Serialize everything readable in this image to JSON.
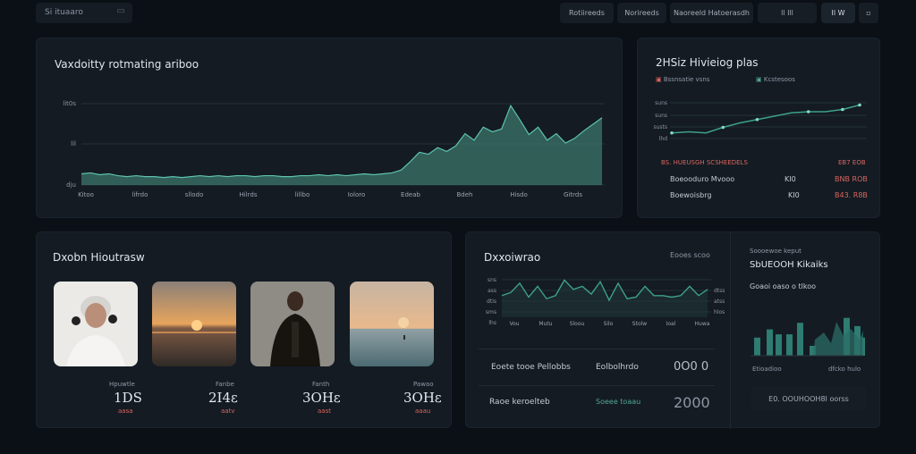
{
  "header": {
    "search": "Si ituaaro",
    "buttons": [
      "Rotiireeds",
      "Norireeds",
      "Naoreeld Hatoerasdh"
    ],
    "icon_buttons": [
      "ll Ill",
      "Il W"
    ]
  },
  "volatility": {
    "title": "Vaxdoitty rotmating ariboo",
    "y_ticks": [
      "lit0s",
      "lil",
      "dju"
    ],
    "x_ticks": [
      "Kitoo",
      "lifrdo",
      "sllodo",
      "Hilrds",
      "lillbo",
      "Ioloro",
      "Edeab",
      "Bdeh",
      "Hisdo",
      "Gitrds"
    ],
    "chart_data": {
      "type": "area",
      "color": "#3f7a6f",
      "values": [
        12,
        13,
        11,
        12,
        10,
        9,
        10,
        9,
        9,
        8,
        9,
        8,
        9,
        10,
        9,
        10,
        9,
        10,
        10,
        9,
        10,
        10,
        9,
        9,
        10,
        10,
        11,
        10,
        11,
        10,
        11,
        12,
        11,
        12,
        13,
        16,
        25,
        35,
        33,
        40,
        36,
        42,
        55,
        48,
        62,
        57,
        60,
        85,
        70,
        54,
        62,
        48,
        55,
        45,
        50,
        58,
        65,
        72
      ]
    }
  },
  "weekly": {
    "title": "2HSiz Hivieiog plas",
    "legend": [
      "Bssnsatie vsns",
      "Kcstesoos"
    ],
    "y_ticks": [
      "suns",
      "suns",
      "susts",
      "lhd"
    ],
    "chart_data": {
      "type": "line",
      "color": "#3ea08a",
      "values": [
        5,
        6,
        5,
        10,
        14,
        17,
        20,
        23,
        24,
        24,
        26,
        30
      ]
    },
    "summary_header_left": "BS. HUEUSGH SCSHEEDELS",
    "summary_header_right": "EB7 EOB",
    "rows": [
      {
        "label": "Boeooduro Mvooo",
        "mid": "KI0",
        "value": "BNB ROB"
      },
      {
        "label": "Boewoisbrg",
        "mid": "KI0",
        "value": "B43. R8B"
      }
    ]
  },
  "media": {
    "title": "Dxobn Hioutrasw",
    "cards": [
      {
        "kind": "portrait",
        "caption": "Hpuwtle",
        "value": "1DS",
        "sub": "aasa"
      },
      {
        "kind": "sunset",
        "caption": "Fanbe",
        "value": "2I4ε",
        "sub": "aatv"
      },
      {
        "kind": "person",
        "caption": "Fanth",
        "value": "3OHε",
        "sub": "aast"
      },
      {
        "kind": "sea",
        "caption": "Pawao",
        "value": "3OHε",
        "sub": "aaau"
      }
    ]
  },
  "bottom": {
    "title": "Dxxoiwrao",
    "right_label": "Eooes scoo",
    "y_ticks": [
      "sns",
      "ass",
      "dtis",
      "sms",
      "lhs"
    ],
    "x_ticks": [
      "Vou",
      "Mutu",
      "Sloou",
      "Silo",
      "Stolw",
      "Ioal",
      "Huwa"
    ],
    "right_ticks": [
      "dtss",
      "atss",
      "hlos"
    ],
    "chart_data": {
      "type": "line",
      "color": "#3ea08a",
      "values": [
        14,
        16,
        22,
        13,
        20,
        12,
        14,
        24,
        18,
        20,
        15,
        23,
        11,
        22,
        12,
        13,
        20,
        14,
        14,
        13,
        14,
        20,
        14,
        18
      ]
    },
    "rows": [
      {
        "label": "Eoete tooe Pellobbs",
        "mid": "Eolbolhrdo",
        "value": "0O0 0"
      },
      {
        "label": "Raoe keroelteb",
        "mid": "Soeee toaau",
        "value": "2000"
      }
    ],
    "side_subtitle": "Soooewoe keput",
    "side_title": "SbUEOOH Kikaiks",
    "side_line": "Goaoi oaso o tlkoo",
    "bars_chart": {
      "type": "bar",
      "color": "#2e7c72",
      "values": [
        22,
        32,
        26,
        26,
        40,
        12,
        46,
        36,
        22
      ]
    },
    "bars_x_ticks": [
      "Etioadioo",
      "dfcko hulo"
    ],
    "side_button": "E0. OOUHOOH8I oorss"
  }
}
